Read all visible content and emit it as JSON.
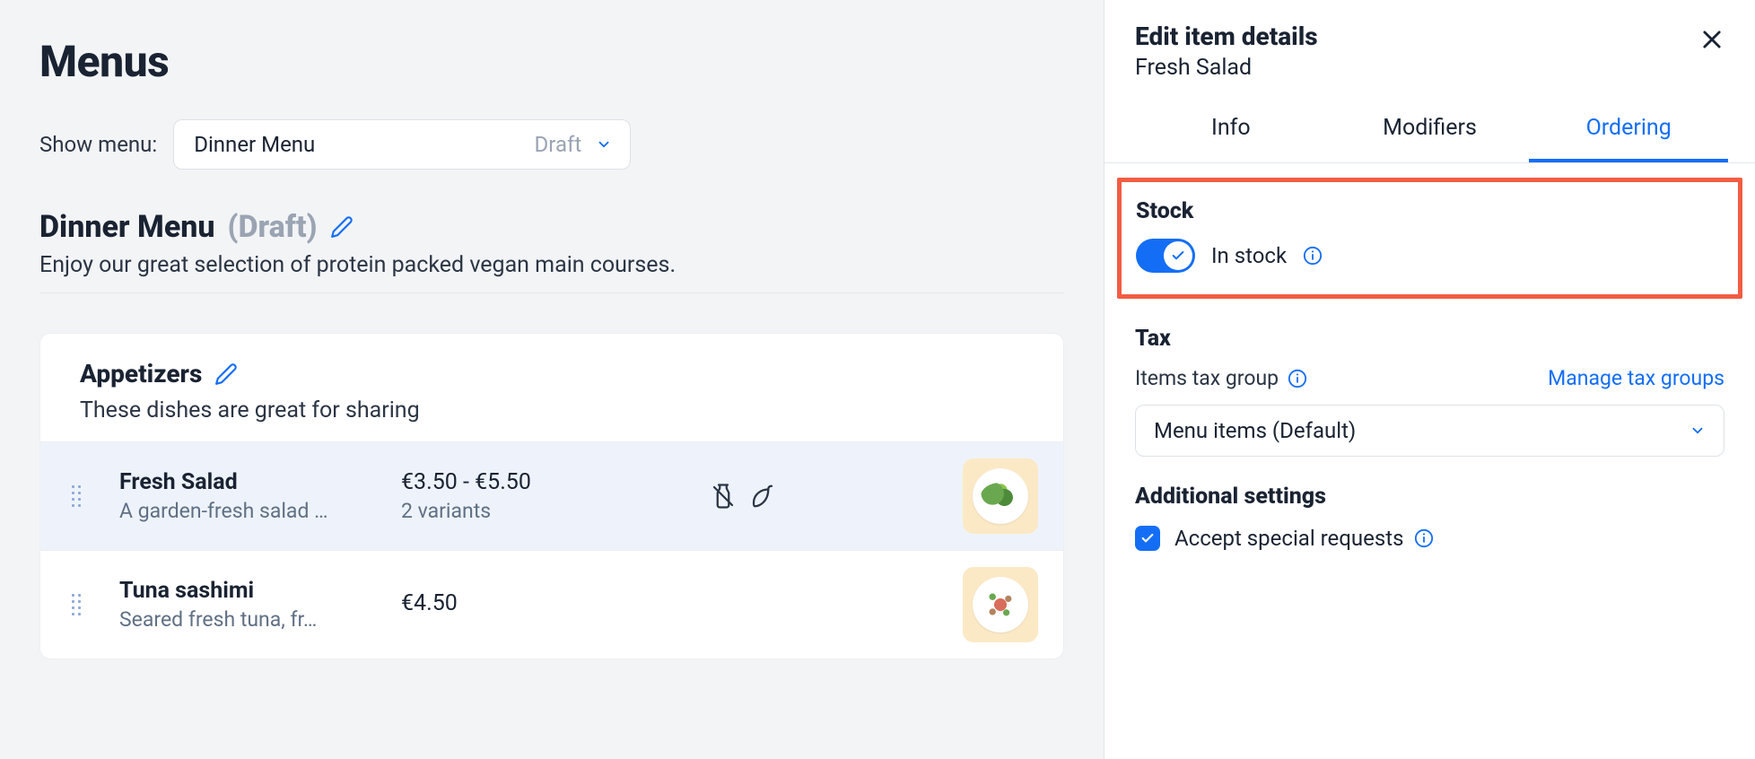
{
  "page": {
    "title": "Menus",
    "show_menu_label": "Show menu:",
    "menu_select": {
      "value": "Dinner Menu",
      "status": "Draft"
    }
  },
  "menu": {
    "name": "Dinner Menu",
    "status": "(Draft)",
    "description": "Enjoy our great selection of protein packed vegan main courses."
  },
  "section": {
    "title": "Appetizers",
    "description": "These dishes are great for sharing"
  },
  "items": [
    {
      "name": "Fresh Salad",
      "description": "A garden-fresh salad …",
      "price": "€3.50 - €5.50",
      "variants": "2 variants",
      "tags": [
        "no-milk",
        "chili"
      ],
      "selected": true,
      "image": "salad"
    },
    {
      "name": "Tuna sashimi",
      "description": "Seared fresh tuna, fr…",
      "price": "€4.50",
      "variants": "",
      "tags": [],
      "selected": false,
      "image": "tuna"
    }
  ],
  "panel": {
    "title": "Edit item details",
    "subtitle": "Fresh Salad",
    "tabs": [
      "Info",
      "Modifiers",
      "Ordering"
    ],
    "active_tab": 2,
    "stock": {
      "heading": "Stock",
      "label": "In stock",
      "on": true
    },
    "tax": {
      "heading": "Tax",
      "group_label": "Items tax group",
      "manage_link": "Manage tax groups",
      "select_value": "Menu items (Default)"
    },
    "additional": {
      "heading": "Additional settings",
      "accept_label": "Accept special requests",
      "accept_checked": true
    }
  }
}
